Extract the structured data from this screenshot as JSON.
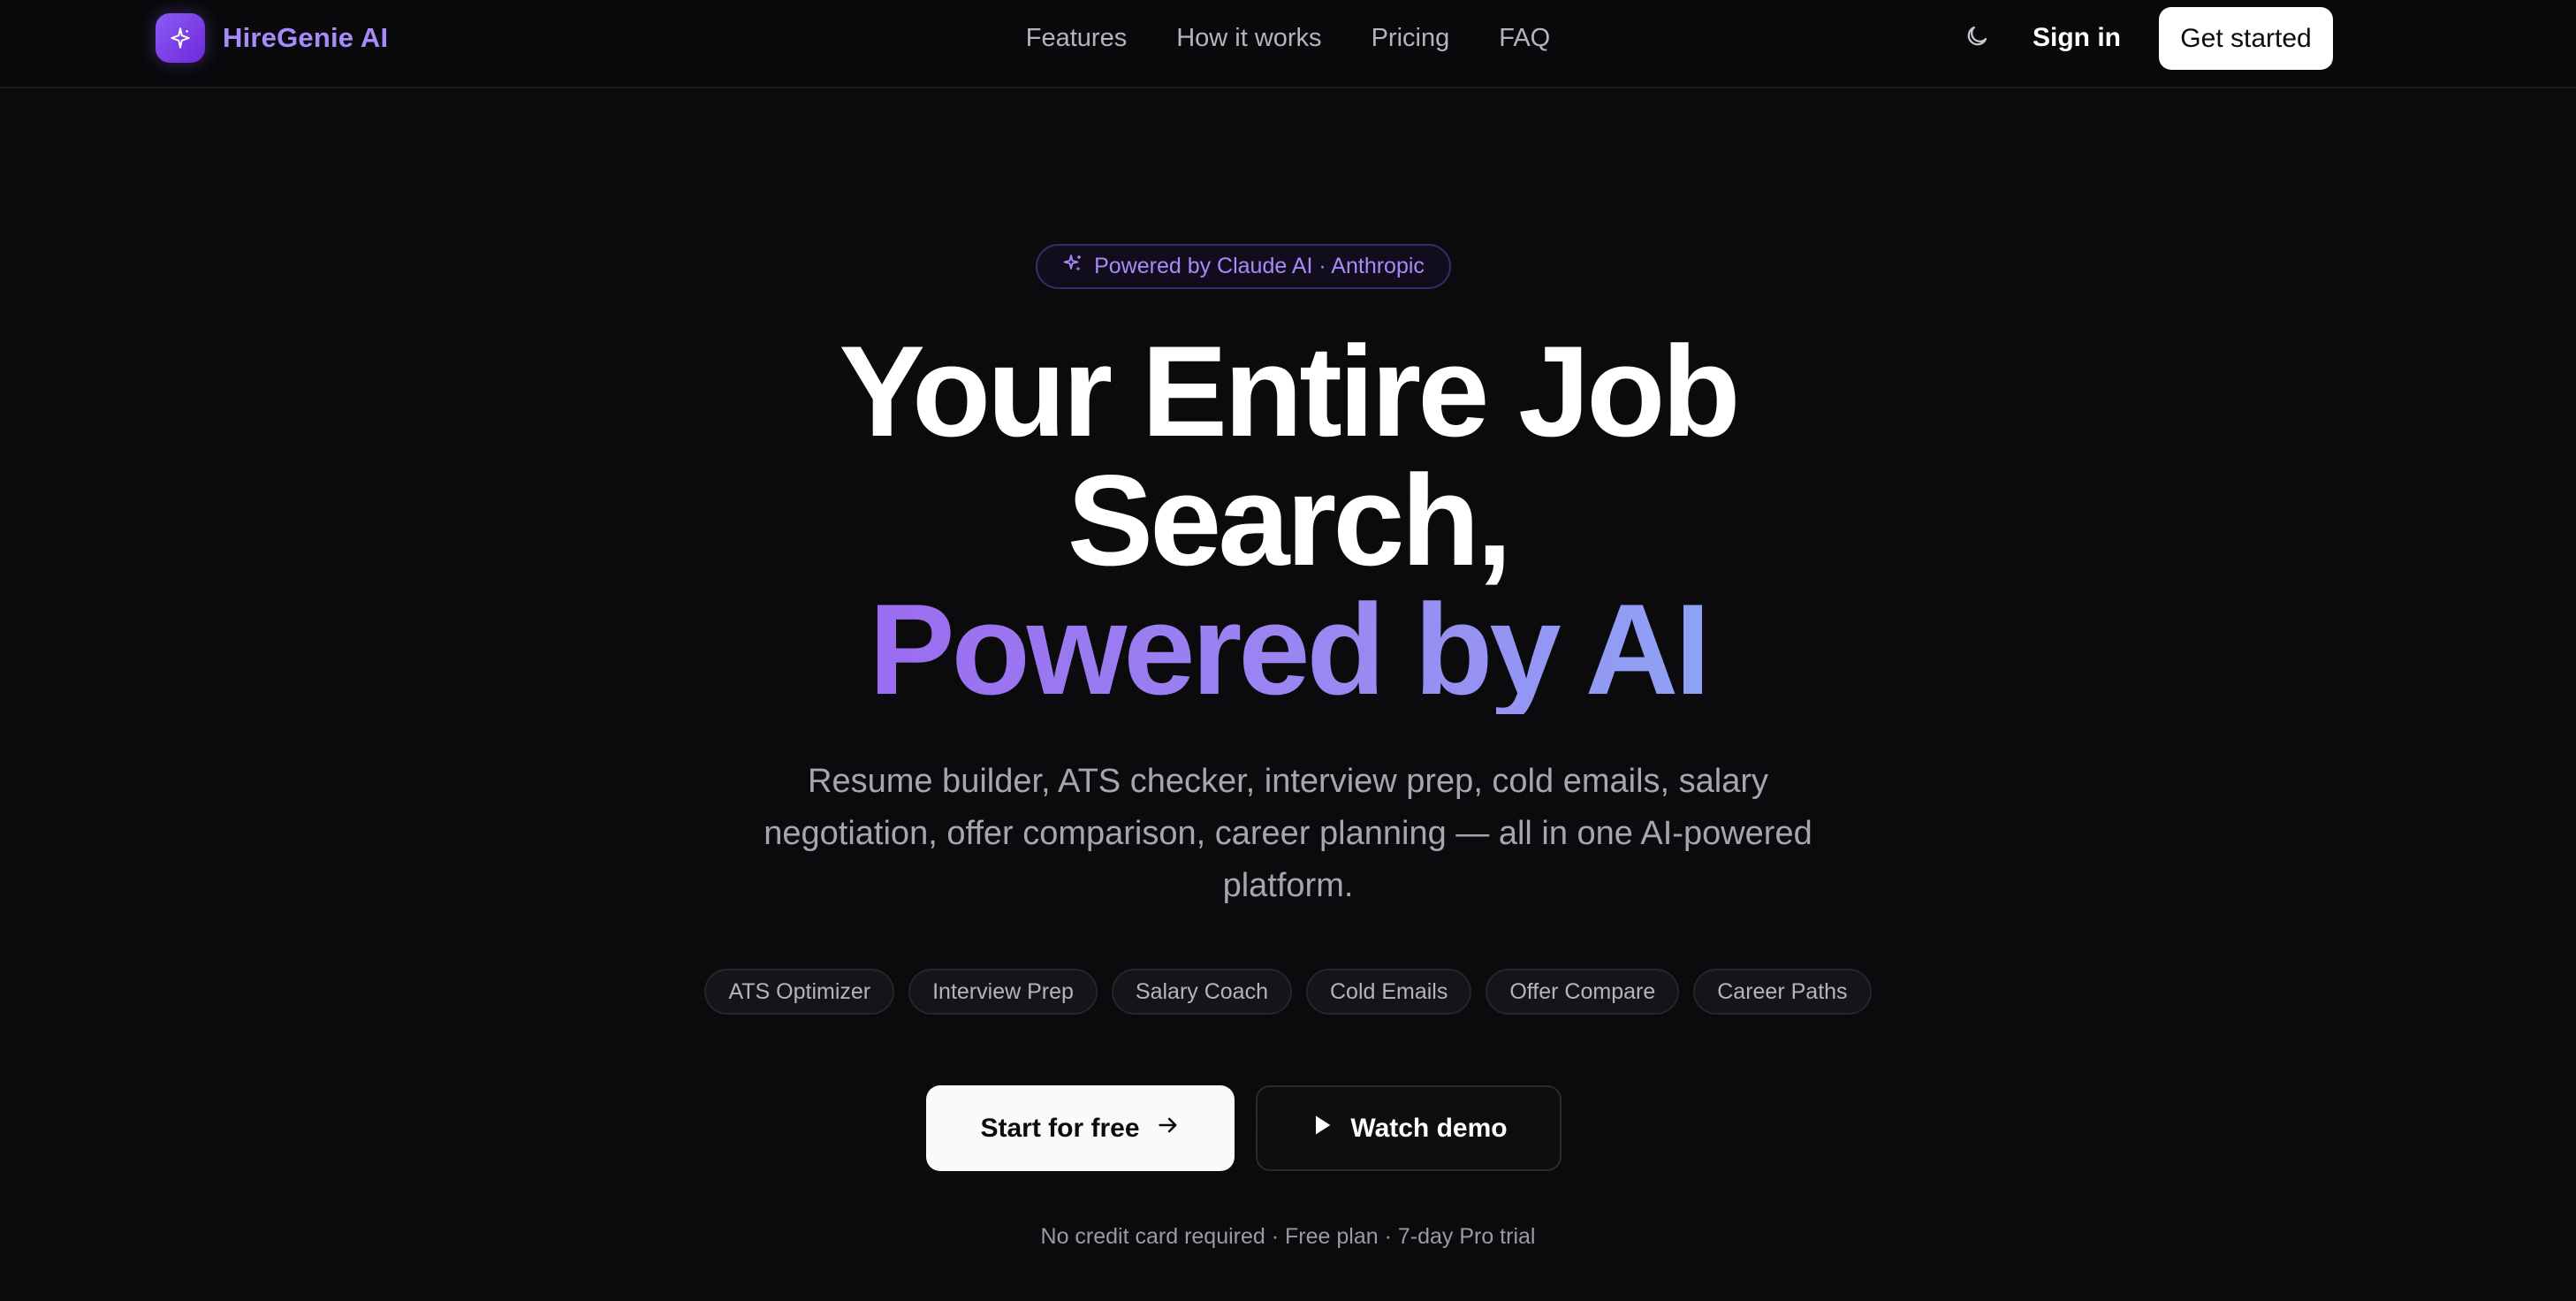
{
  "brand": {
    "name": "HireGenie AI",
    "logo_icon": "sparkle-icon",
    "accent_color": "#a78bfa"
  },
  "nav": {
    "links": [
      "Features",
      "How it works",
      "Pricing",
      "FAQ"
    ],
    "theme_toggle_icon": "moon-icon",
    "sign_in_label": "Sign in",
    "get_started_label": "Get started"
  },
  "hero": {
    "badge_icon": "sparkles-icon",
    "badge_text": "Powered by Claude AI · Anthropic",
    "headline_line1": "Your Entire Job",
    "headline_line2": "Search,",
    "headline_accent": "Powered by AI",
    "subtitle": "Resume builder, ATS checker, interview prep, cold emails, salary negotiation, offer comparison, career planning — all in one AI-powered platform.",
    "chips": [
      "ATS Optimizer",
      "Interview Prep",
      "Salary Coach",
      "Cold Emails",
      "Offer Compare",
      "Career Paths"
    ],
    "primary_cta": "Start for free",
    "primary_cta_icon": "arrow-right-icon",
    "secondary_cta": "Watch demo",
    "secondary_cta_icon": "play-icon",
    "footnote": "No credit card required · Free plan · 7-day Pro trial"
  },
  "colors": {
    "background": "#0b0b0d",
    "gradient_start": "#9b6cf0",
    "gradient_end": "#8ea2f5",
    "button_light": "#fafafa"
  }
}
